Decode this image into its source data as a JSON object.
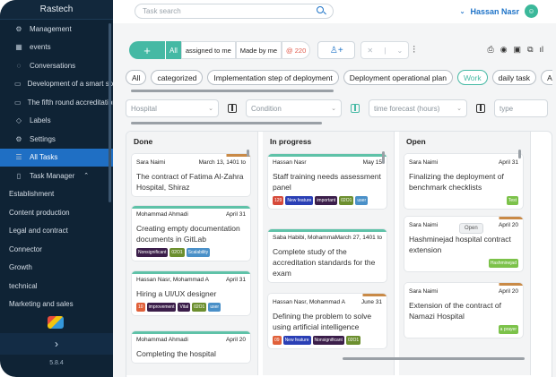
{
  "sidebar": {
    "title": "Rastech",
    "items": [
      {
        "label": "Management",
        "icon": "gear-icon",
        "glyph": "⚙"
      },
      {
        "label": "events",
        "icon": "grid-icon",
        "glyph": "▦"
      },
      {
        "label": "Conversations",
        "icon": "chat-icon",
        "glyph": "◌"
      },
      {
        "label": "Development of a smart solution",
        "icon": "folder-icon",
        "glyph": "▭"
      },
      {
        "label": "The fifth round accreditation",
        "icon": "folder-icon",
        "glyph": "▭"
      },
      {
        "label": "Labels",
        "icon": "tag-icon",
        "glyph": "◇"
      },
      {
        "label": "Settings",
        "icon": "gear-icon",
        "glyph": "⚙"
      },
      {
        "label": "All Tasks",
        "icon": "list-icon",
        "glyph": "☰"
      },
      {
        "label": "Task Manager",
        "icon": "clipboard-icon",
        "glyph": "▯"
      }
    ],
    "sub_items": [
      "Establishment",
      "Content production",
      "Legal and contract",
      "Connector",
      "Growth",
      "technical",
      "Marketing and sales"
    ],
    "collapse_glyph": "›",
    "version": "5.8.4"
  },
  "topbar": {
    "search_placeholder": "Task search",
    "user_name": "Hassan Nasr",
    "avatar_initial": "☺"
  },
  "toolbar": {
    "add_label": "+",
    "all_label": "All",
    "assigned_label": "assigned to me",
    "made_label": "Made by me",
    "count_label": "@ 220",
    "adduser_glyph": "♙+",
    "select_clear": "✕",
    "select_sep": "|",
    "select_caret": "⌄",
    "sliders_glyph": "⫶",
    "right_icons": [
      "⎙",
      "◉",
      "▣",
      "⧉",
      "ıl"
    ]
  },
  "categories": [
    "All",
    "categorized",
    "Implementation step of deployment",
    "Deployment operational plan",
    "Work",
    "daily task",
    "Action p"
  ],
  "active_category": "Work",
  "filters": {
    "hospital_placeholder": "Hospital",
    "condition_placeholder": "Condition",
    "time_placeholder": "time forecast (hours)",
    "type_placeholder": "type",
    "caret": "⌄"
  },
  "columns": [
    {
      "title": "Done",
      "cards": [
        {
          "who": "Sara Naimi",
          "date": "March 13, 1401 to",
          "title": "The contract of Fatima Al-Zahra Hospital, Shiraz",
          "bar": "#ffffff",
          "corner": "#c98a47",
          "tags": []
        },
        {
          "who": "Mohammad Ahmadi",
          "date": "April 31",
          "title": "Creating empty documentation documents in GitLab",
          "bar": "#5fc2a8",
          "tags": [
            {
              "t": "Nonsignificant",
              "c": "#3b1e4a"
            },
            {
              "t": "02O1",
              "c": "#6c8f2f"
            },
            {
              "t": "Scalability",
              "c": "#4a90c8"
            }
          ]
        },
        {
          "who": "Hassan Nasr, Mohammad A",
          "date": "April 31",
          "title": "Hiring a UI/UX designer",
          "bar": "#5fc2a8",
          "tags": [
            {
              "t": "10",
              "c": "#e0603a"
            },
            {
              "t": "improvement",
              "c": "#3b1e4a"
            },
            {
              "t": "Vital",
              "c": "#3b1e4a"
            },
            {
              "t": "02O1",
              "c": "#6c8f2f"
            },
            {
              "t": "user",
              "c": "#4a90c8"
            }
          ]
        },
        {
          "who": "Mohammad Ahmadi",
          "date": "April 20",
          "title": "Completing the hospital",
          "bar": "#5fc2a8",
          "tags": []
        }
      ]
    },
    {
      "title": "In progress",
      "cards": [
        {
          "who": "Hassan Nasr",
          "date": "May 15",
          "title": "Staff training needs assessment panel",
          "bar": "#5fc2a8",
          "tags": [
            {
              "t": "129",
              "c": "#d64a3a"
            },
            {
              "t": "New feature",
              "c": "#2a3fb5"
            },
            {
              "t": "important",
              "c": "#3b1e4a"
            },
            {
              "t": "02O1",
              "c": "#6c8f2f"
            },
            {
              "t": "user",
              "c": "#4a90c8"
            }
          ]
        },
        {
          "who": "Saba Habibi, Mohammad A",
          "date": "March 27, 1401 to",
          "title": "Complete study of the accreditation standards for the exam",
          "bar": "#5fc2a8",
          "tags": []
        },
        {
          "who": "Hassan Nasr, Mohammad A",
          "date": "June 31",
          "title": "Defining the problem to solve using artificial intelligence",
          "bar": "#ffffff",
          "corner": "#c98a47",
          "tags": [
            {
              "t": "09",
              "c": "#e0603a"
            },
            {
              "t": "New feature",
              "c": "#2a3fb5"
            },
            {
              "t": "Nonsignificant",
              "c": "#3b1e4a"
            },
            {
              "t": "02O1",
              "c": "#6c8f2f"
            }
          ]
        }
      ]
    },
    {
      "title": "Open",
      "cards": [
        {
          "who": "Sara Naimi",
          "date": "April 31",
          "title": "Finalizing the deployment of benchmark checklists",
          "bar": "#ffffff",
          "tags": [
            {
              "t": "Test",
              "c": "#7cc24a",
              "right": true
            }
          ]
        },
        {
          "who": "Sara Naimi",
          "date": "April 20",
          "title": "Hashminejad hospital contract extension",
          "bar": "#ffffff",
          "corner": "#c98a47",
          "tags": [
            {
              "t": "Hashminejad",
              "c": "#7cc24a",
              "right": true
            }
          ]
        },
        {
          "who": "Sara Naimi",
          "date": "April 20",
          "title": "Extension of the contract of Namazi Hospital",
          "bar": "#ffffff",
          "corner": "#c98a47",
          "tags": [
            {
              "t": "a prayer",
              "c": "#7cc24a",
              "right": true
            }
          ]
        }
      ]
    }
  ],
  "open_tooltip": "Open"
}
